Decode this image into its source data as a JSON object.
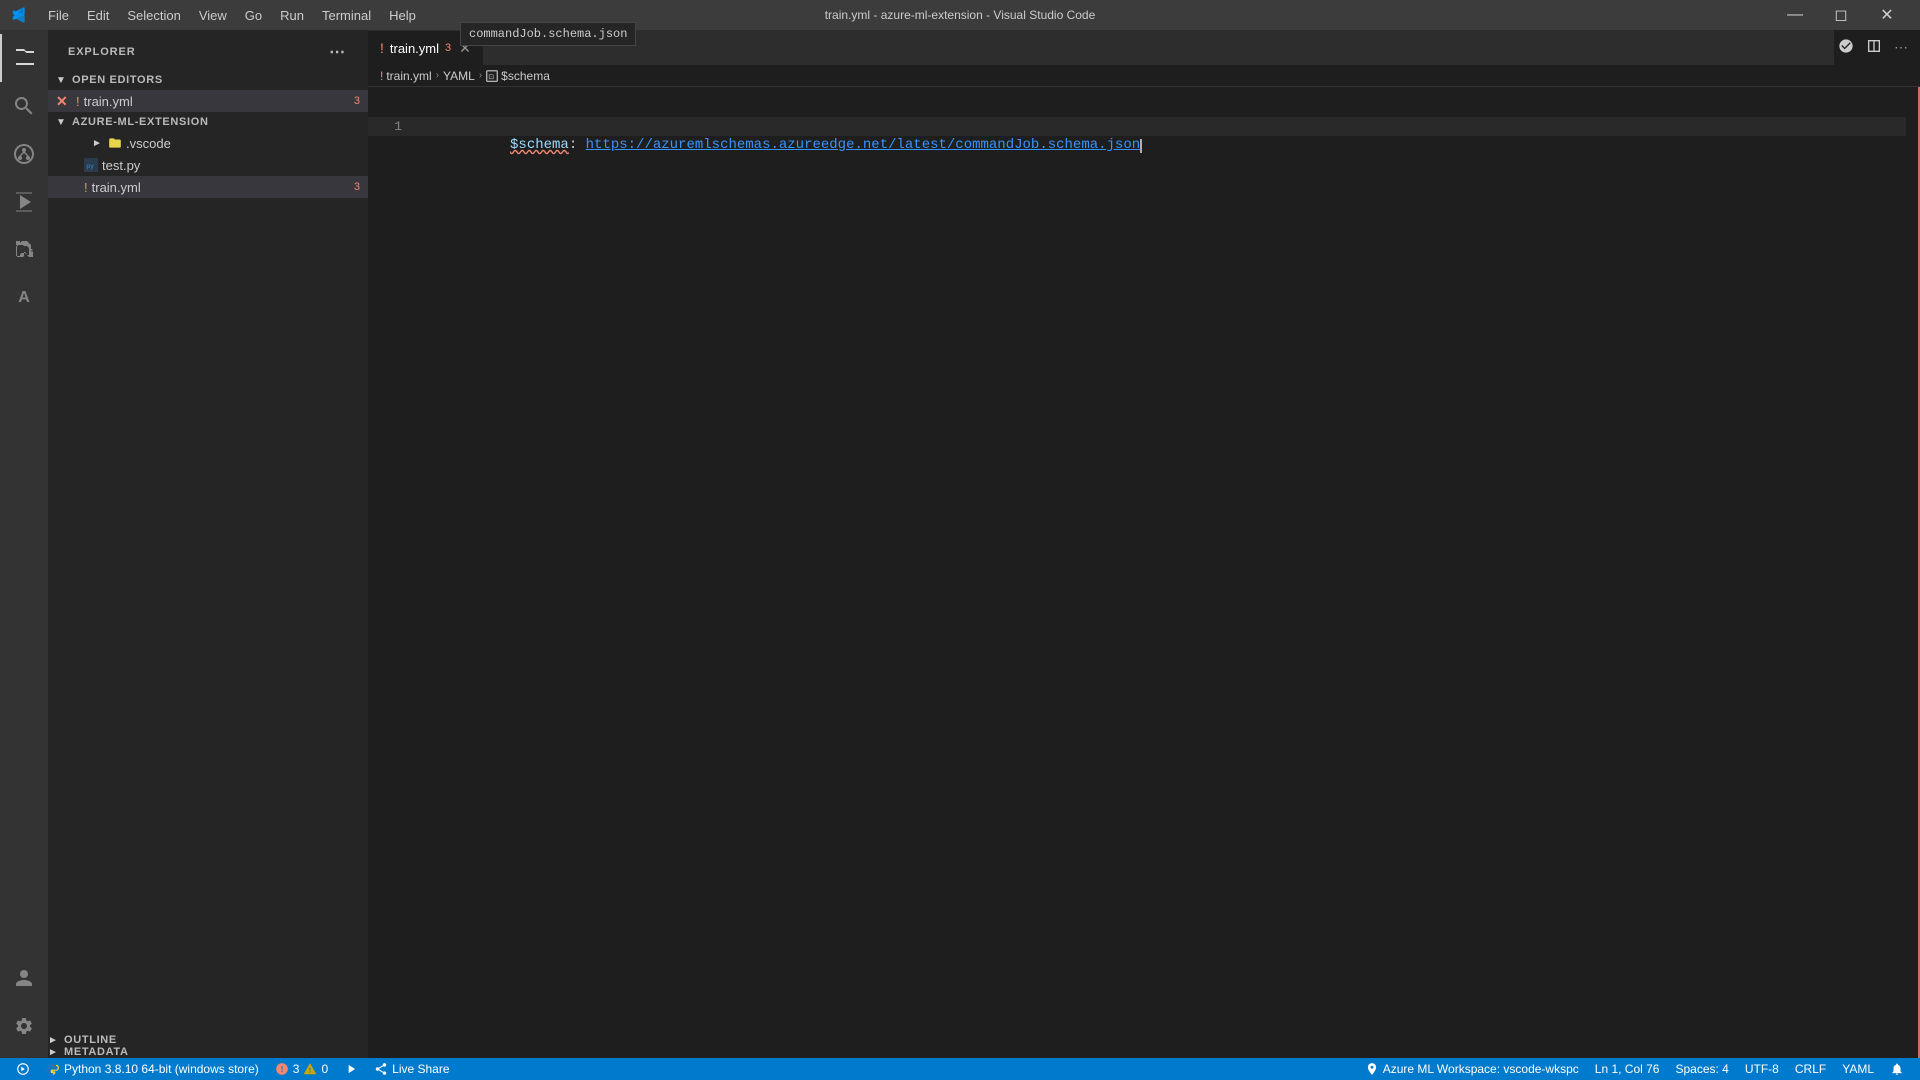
{
  "window": {
    "title": "train.yml - azure-ml-extension - Visual Studio Code",
    "minimize_label": "minimize",
    "maximize_label": "maximize",
    "close_label": "close"
  },
  "titlebar": {
    "menus": [
      "File",
      "Edit",
      "Selection",
      "View",
      "Go",
      "Run",
      "Terminal",
      "Help"
    ]
  },
  "activity_bar": {
    "items": [
      {
        "name": "explorer",
        "icon": "⬜",
        "label": "Explorer"
      },
      {
        "name": "search",
        "icon": "🔍",
        "label": "Search"
      },
      {
        "name": "source-control",
        "icon": "⑂",
        "label": "Source Control"
      },
      {
        "name": "run",
        "icon": "▶",
        "label": "Run"
      },
      {
        "name": "extensions",
        "icon": "⊞",
        "label": "Extensions"
      },
      {
        "name": "azure",
        "icon": "Ⓐ",
        "label": "Azure"
      }
    ],
    "bottom_items": [
      {
        "name": "accounts",
        "icon": "👤",
        "label": "Accounts"
      },
      {
        "name": "settings",
        "icon": "⚙",
        "label": "Settings"
      }
    ]
  },
  "sidebar": {
    "title": "Explorer",
    "sections": {
      "open_editors": {
        "label": "Open Editors",
        "files": [
          {
            "name": "train.yml",
            "has_error": true,
            "badge": "3",
            "active": true
          }
        ]
      },
      "project": {
        "label": "Azure-ML-Extension",
        "folders": [
          {
            "name": ".vscode",
            "expanded": false
          }
        ],
        "files": [
          {
            "name": "test.py",
            "icon": "py"
          },
          {
            "name": "train.yml",
            "has_error": true,
            "badge": "3",
            "active": true
          }
        ]
      },
      "outline": {
        "label": "Outline"
      },
      "metadata": {
        "label": "Metadata"
      }
    }
  },
  "editor": {
    "tab": {
      "filename": "train.yml",
      "badge": "3",
      "has_error": true
    },
    "breadcrumb": {
      "file": "train.yml",
      "section": "YAML",
      "symbol": "$schema"
    },
    "tooltip": "commandJob.schema.json",
    "lines": [
      {
        "number": 1,
        "key": "$schema:",
        "value": "https://azuremlschemas.azureedge.net/latest/commandJob.schema.json",
        "is_link": true
      }
    ],
    "cursor": {
      "line": 1,
      "col": 76
    }
  },
  "status_bar": {
    "branch_icon": "⎇",
    "python": "Python 3.8.10 64-bit (windows store)",
    "errors": "3",
    "warnings": "0",
    "run_icon": "▶",
    "live_share": "Live Share",
    "workspace": "Azure ML Workspace: vscode-wkspc",
    "position": "Ln 1, Col 76",
    "spaces": "Spaces: 4",
    "encoding": "UTF-8",
    "line_ending": "CRLF",
    "language": "YAML",
    "bell": "🔔"
  }
}
